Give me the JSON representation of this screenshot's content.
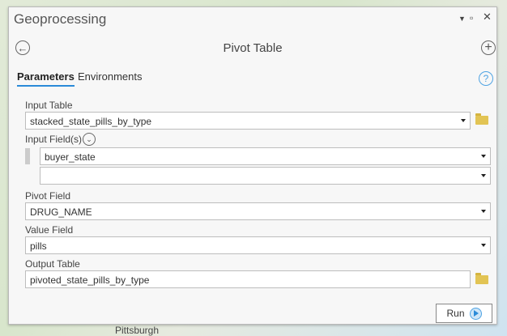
{
  "window": {
    "title": "Geoprocessing",
    "menu_icon": "dropdown-icon",
    "maximize_icon": "maximize-icon",
    "close_icon": "close-icon"
  },
  "tool": {
    "title": "Pivot Table"
  },
  "tabs": [
    {
      "label": "Parameters",
      "active": true
    },
    {
      "label": "Environments",
      "active": false
    }
  ],
  "params": {
    "input_table": {
      "label": "Input Table",
      "value": "stacked_state_pills_by_type"
    },
    "input_fields": {
      "label": "Input Field(s)",
      "values": [
        "buyer_state",
        ""
      ]
    },
    "pivot_field": {
      "label": "Pivot Field",
      "value": "DRUG_NAME"
    },
    "value_field": {
      "label": "Value Field",
      "value": "pills"
    },
    "output_table": {
      "label": "Output Table",
      "value": "pivoted_state_pills_by_type"
    }
  },
  "run_label": "Run",
  "map": {
    "label": "Pittsburgh"
  },
  "colors": {
    "accent": "#2a8ad8",
    "folder": "#e2c454"
  }
}
